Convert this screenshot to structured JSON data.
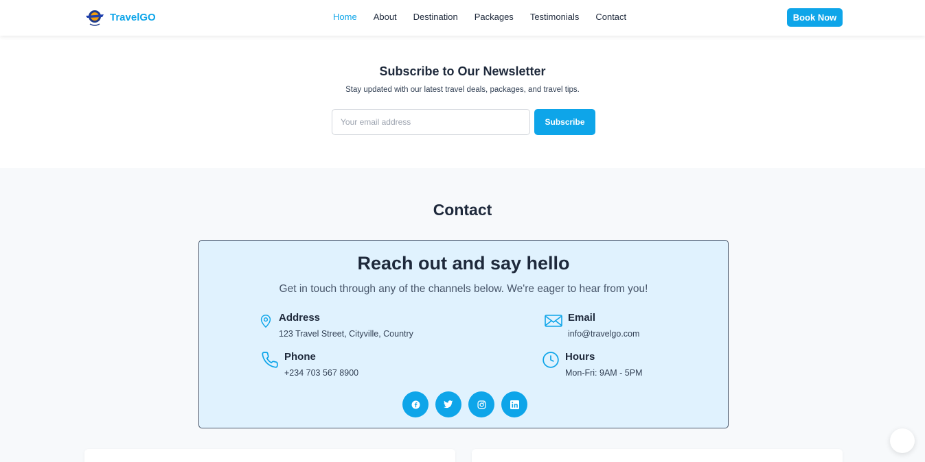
{
  "brand": {
    "name": "TravelGO",
    "accent": "#0ea5e9"
  },
  "nav": {
    "items": [
      {
        "label": "Home",
        "active": true
      },
      {
        "label": "About"
      },
      {
        "label": "Destination"
      },
      {
        "label": "Packages"
      },
      {
        "label": "Testimonials"
      },
      {
        "label": "Contact"
      }
    ],
    "cta_label": "Book Now"
  },
  "newsletter": {
    "title": "Subscribe to Our Newsletter",
    "subtitle": "Stay updated with our latest travel deals, packages, and travel tips.",
    "email_placeholder": "Your email address",
    "button_label": "Subscribe"
  },
  "contact": {
    "heading": "Contact",
    "card_title": "Reach out and say hello",
    "card_subtitle": "Get in touch through any of the channels below. We're eager to hear from you!",
    "address": {
      "label": "Address",
      "value": "123 Travel Street, Cityville, Country",
      "icon": "map-pin-icon"
    },
    "email": {
      "label": "Email",
      "value": "info@travelgo.com",
      "icon": "envelope-icon"
    },
    "phone": {
      "label": "Phone",
      "value": "+234 703 567 8900",
      "icon": "phone-icon"
    },
    "hours": {
      "label": "Hours",
      "value": "Mon-Fri: 9AM - 5PM",
      "icon": "clock-icon"
    },
    "socials": [
      "facebook-icon",
      "twitter-icon",
      "instagram-icon",
      "linkedin-icon"
    ]
  }
}
